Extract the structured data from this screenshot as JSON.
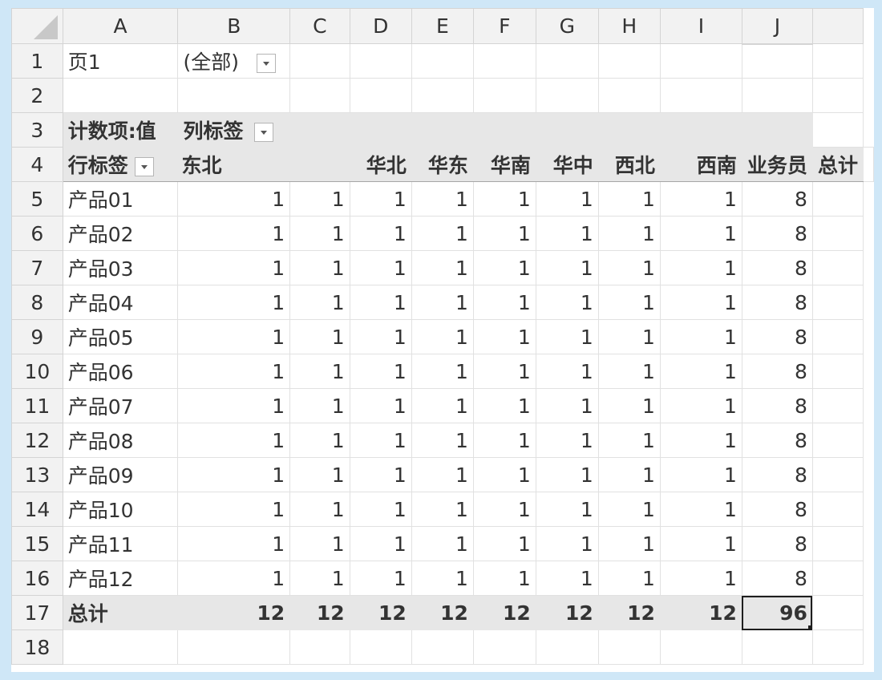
{
  "columns": [
    "A",
    "B",
    "C",
    "D",
    "E",
    "F",
    "G",
    "H",
    "I",
    "J"
  ],
  "row_numbers": [
    "1",
    "2",
    "3",
    "4",
    "5",
    "6",
    "7",
    "8",
    "9",
    "10",
    "11",
    "12",
    "13",
    "14",
    "15",
    "16",
    "17",
    "18"
  ],
  "filter": {
    "label": "页1",
    "value": "(全部)"
  },
  "pivot_header": {
    "value_label": "计数项:值",
    "col_label": "列标签",
    "row_label": "行标签"
  },
  "col_headers": [
    "东北",
    "华北",
    "华东",
    "华南",
    "华中",
    "西北",
    "西南",
    "业务员",
    "总计"
  ],
  "rows": [
    {
      "name": "产品01",
      "values": [
        "1",
        "1",
        "1",
        "1",
        "1",
        "1",
        "1",
        "1",
        "8"
      ]
    },
    {
      "name": "产品02",
      "values": [
        "1",
        "1",
        "1",
        "1",
        "1",
        "1",
        "1",
        "1",
        "8"
      ]
    },
    {
      "name": "产品03",
      "values": [
        "1",
        "1",
        "1",
        "1",
        "1",
        "1",
        "1",
        "1",
        "8"
      ]
    },
    {
      "name": "产品04",
      "values": [
        "1",
        "1",
        "1",
        "1",
        "1",
        "1",
        "1",
        "1",
        "8"
      ]
    },
    {
      "name": "产品05",
      "values": [
        "1",
        "1",
        "1",
        "1",
        "1",
        "1",
        "1",
        "1",
        "8"
      ]
    },
    {
      "name": "产品06",
      "values": [
        "1",
        "1",
        "1",
        "1",
        "1",
        "1",
        "1",
        "1",
        "8"
      ]
    },
    {
      "name": "产品07",
      "values": [
        "1",
        "1",
        "1",
        "1",
        "1",
        "1",
        "1",
        "1",
        "8"
      ]
    },
    {
      "name": "产品08",
      "values": [
        "1",
        "1",
        "1",
        "1",
        "1",
        "1",
        "1",
        "1",
        "8"
      ]
    },
    {
      "name": "产品09",
      "values": [
        "1",
        "1",
        "1",
        "1",
        "1",
        "1",
        "1",
        "1",
        "8"
      ]
    },
    {
      "name": "产品10",
      "values": [
        "1",
        "1",
        "1",
        "1",
        "1",
        "1",
        "1",
        "1",
        "8"
      ]
    },
    {
      "name": "产品11",
      "values": [
        "1",
        "1",
        "1",
        "1",
        "1",
        "1",
        "1",
        "1",
        "8"
      ]
    },
    {
      "name": "产品12",
      "values": [
        "1",
        "1",
        "1",
        "1",
        "1",
        "1",
        "1",
        "1",
        "8"
      ]
    }
  ],
  "total": {
    "label": "总计",
    "values": [
      "12",
      "12",
      "12",
      "12",
      "12",
      "12",
      "12",
      "12",
      "96"
    ]
  }
}
